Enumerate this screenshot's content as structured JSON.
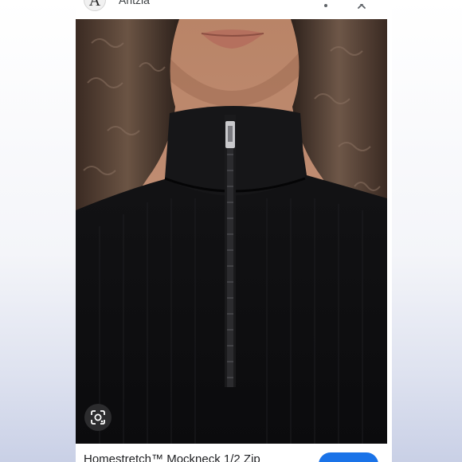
{
  "source": {
    "logo_letter": "A",
    "name": "Aritzia"
  },
  "header": {
    "more_icon": "more-vert-icon",
    "close_icon": "close-icon"
  },
  "image": {
    "description_icon": "lens-icon"
  },
  "product": {
    "title": "Homestretch™ Mockneck 1/2 Zip"
  },
  "visit_button": {
    "label": "",
    "color": "#1a73e8"
  },
  "colors": {
    "garment": "#0e0e10",
    "background_gradient_bottom": "#c9d0e6"
  }
}
